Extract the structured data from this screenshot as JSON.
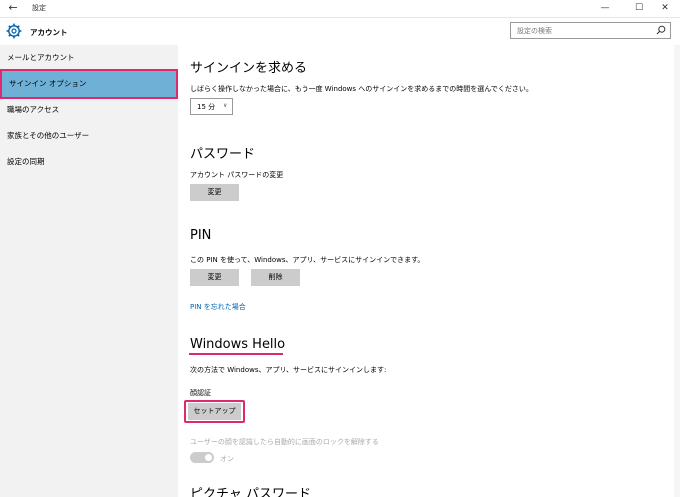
{
  "titlebar": {
    "title": "設定",
    "back_icon": "back-arrow-icon",
    "minimize": "—",
    "maximize": "☐",
    "close": "✕"
  },
  "header": {
    "app_title": "アカウント",
    "search_placeholder": "設定の検索"
  },
  "sidebar": {
    "items": [
      {
        "label": "メールとアカウント",
        "selected": false
      },
      {
        "label": "サインイン オプション",
        "selected": true
      },
      {
        "label": "職場のアクセス",
        "selected": false
      },
      {
        "label": "家族とその他のユーザー",
        "selected": false
      },
      {
        "label": "設定の同期",
        "selected": false
      }
    ]
  },
  "content": {
    "require_signin": {
      "heading": "サインインを求める",
      "description": "しばらく操作しなかった場合に、もう一度 Windows へのサインインを求めるまでの時間を選んでください。",
      "dropdown_value": "15 分"
    },
    "password": {
      "heading": "パスワード",
      "description": "アカウント パスワードの変更",
      "change_label": "変更"
    },
    "pin": {
      "heading": "PIN",
      "description": "この PIN を使って、Windows、アプリ、サービスにサインインできます。",
      "change_label": "変更",
      "remove_label": "削除",
      "forgot_link": "PIN を忘れた場合"
    },
    "hello": {
      "heading": "Windows Hello",
      "description": "次の方法で Windows、アプリ、サービスにサインインします:",
      "face_label": "顔認証",
      "setup_label": "セットアップ",
      "auto_unlock_label": "ユーザーの顔を認識したら自動的に画面のロックを解除する",
      "toggle_label": "オン"
    },
    "picture_password": {
      "heading": "ピクチャ パスワード"
    }
  },
  "colors": {
    "accent": "#0063b1",
    "selected_bg": "#6eb0d6",
    "highlight": "#e0286e"
  }
}
